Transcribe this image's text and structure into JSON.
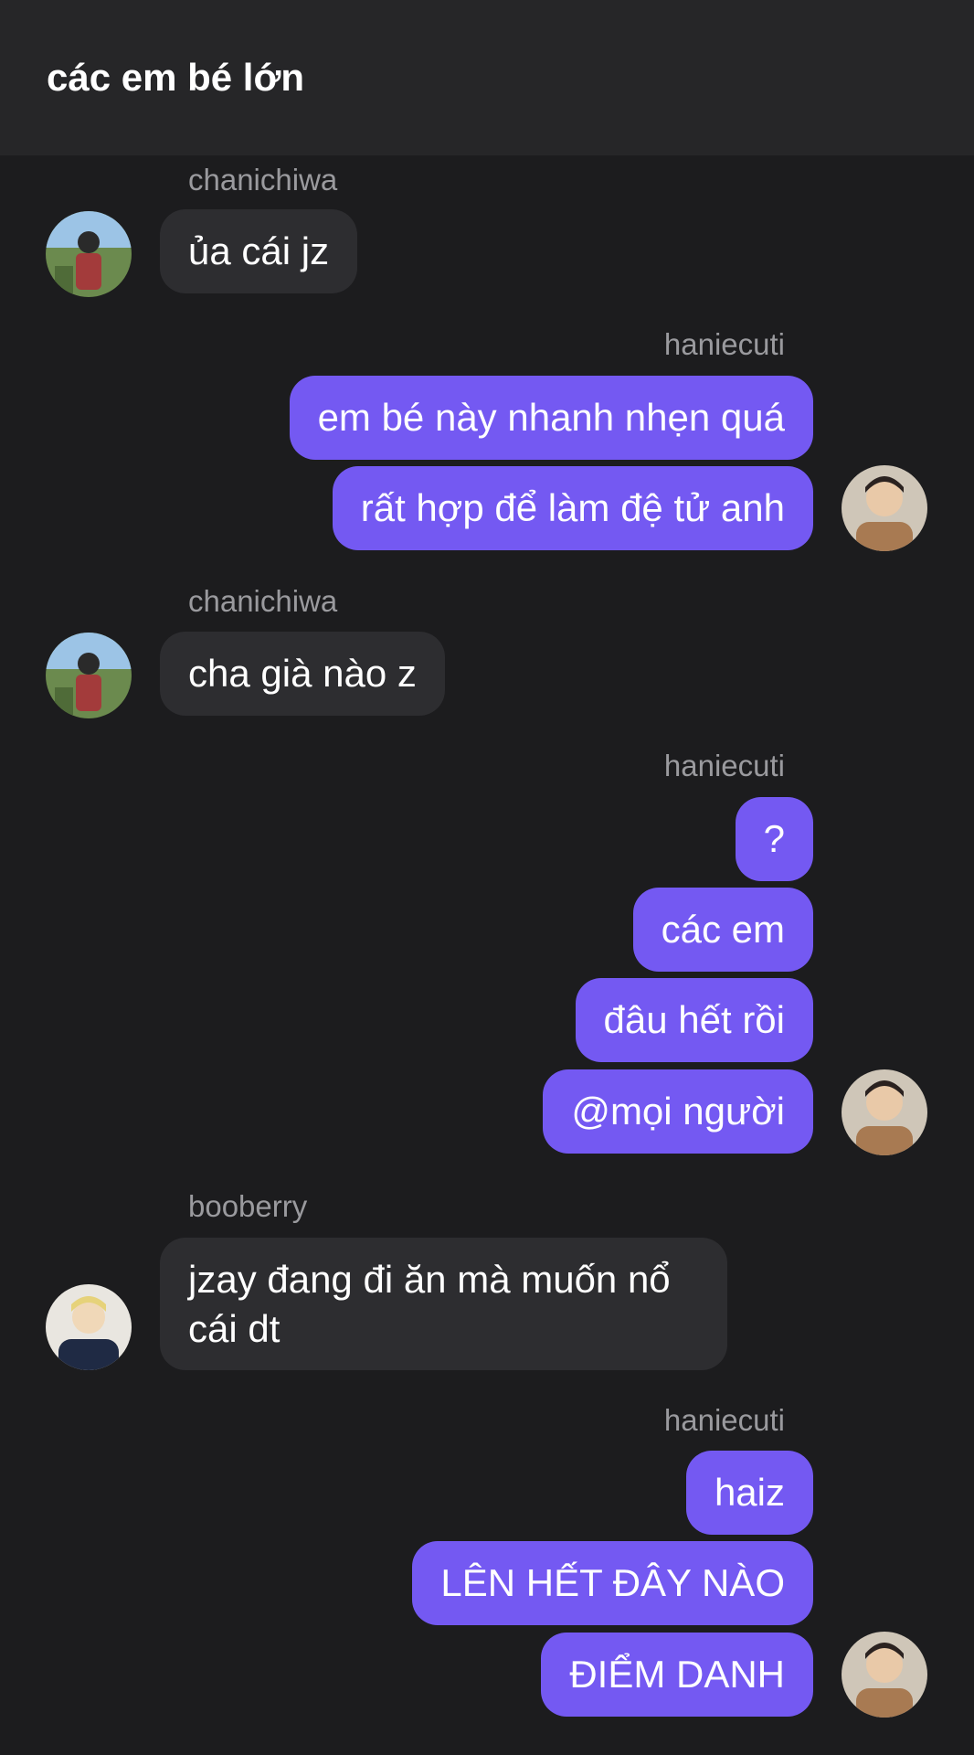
{
  "header": {
    "title": "các em bé lớn"
  },
  "messages": [
    {
      "sender": "chanichiwa",
      "bubbles": [
        "ủa cái jz"
      ]
    },
    {
      "sender": "haniecuti",
      "bubbles": [
        "em bé này nhanh nhẹn quá",
        "rất hợp để làm đệ tử anh"
      ]
    },
    {
      "sender": "chanichiwa",
      "bubbles": [
        "cha già nào z"
      ]
    },
    {
      "sender": "haniecuti",
      "bubbles": [
        "?",
        "các em",
        "đâu hết rồi",
        "@mọi người"
      ]
    },
    {
      "sender": "booberry",
      "bubbles": [
        "jzay đang đi ăn mà muốn nổ cái dt"
      ]
    },
    {
      "sender": "haniecuti",
      "bubbles": [
        "haiz",
        "LÊN HẾT ĐÂY NÀO",
        "ĐIỂM DANH"
      ]
    }
  ],
  "colors": {
    "background": "#1c1c1e",
    "header": "#262628",
    "incoming_bubble": "#2d2d30",
    "outgoing_bubble": "#7459f2",
    "sender_name": "#9a9a9e"
  }
}
